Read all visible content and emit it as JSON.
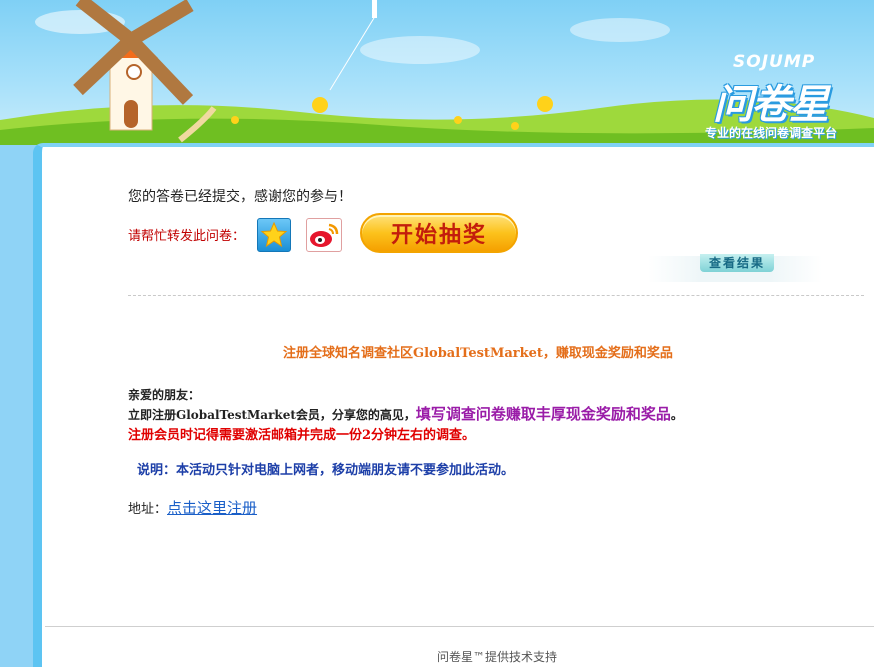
{
  "brand": {
    "en": "SOJUMP",
    "cn": "问卷星",
    "tagline": "专业的在线问卷调查平台"
  },
  "submit_message": "您的答卷已经提交，感谢您的参与！",
  "share": {
    "label": "请帮忙转发此问卷：",
    "qzone_icon": "qzone-icon",
    "weibo_icon": "weibo-icon"
  },
  "lottery_button": "开始抽奖",
  "view_result_button": "查看结果",
  "promo": {
    "title": "注册全球知名调查社区GlobalTestMarket，赚取现金奖励和奖品",
    "dear": "亲爱的朋友：",
    "line2_a": "立即注册GlobalTestMarket会员，分享您的高见，",
    "line2_highlight": "填写调查问卷赚取丰厚现金奖励和奖品",
    "line2_end": "。",
    "line3": "注册会员时记得需要激活邮箱并完成一份2分钟左右的调查。",
    "note": "说明：本活动只针对电脑上网者，移动端朋友请不要参加此活动。",
    "address_label": "地址：",
    "address_link": "点击这里注册"
  },
  "footer": "问卷星™提供技术支持",
  "colors": {
    "accent_red": "#c00000",
    "link_blue": "#1a5fc8",
    "promo_orange": "#e46e1a",
    "highlight_purple": "#9a1ca8"
  }
}
